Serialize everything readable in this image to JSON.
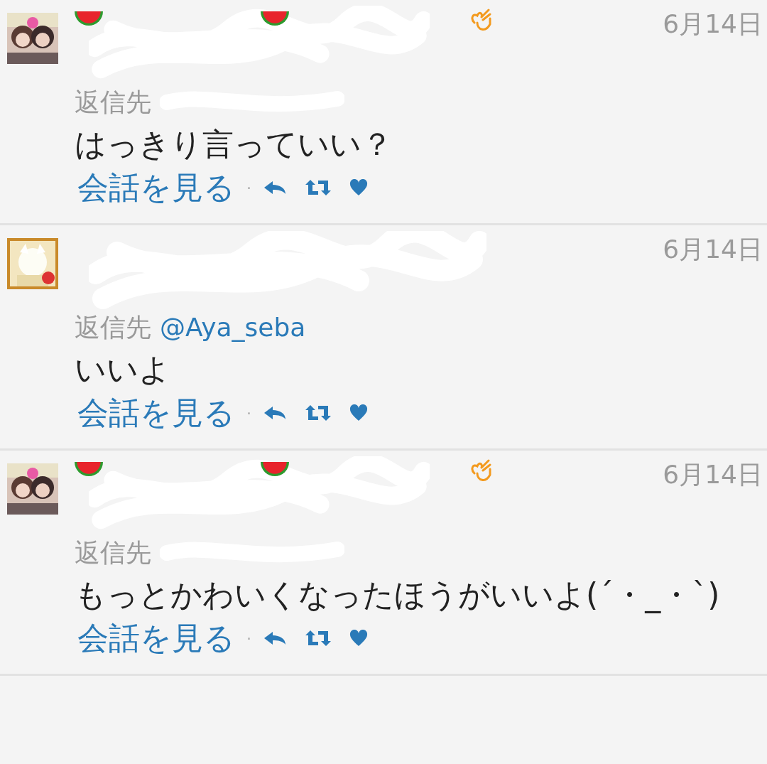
{
  "tweets": [
    {
      "kind": "decorated",
      "date": "6月14日",
      "reply_label": "返信先",
      "body": "はっきり言っていい？",
      "conversation_link": "会話を見る",
      "separator": "·"
    },
    {
      "kind": "plain",
      "date": "6月14日",
      "reply_label": "返信先",
      "reply_handle": "@Aya_seba",
      "body": "いいよ",
      "conversation_link": "会話を見る",
      "separator": "·"
    },
    {
      "kind": "decorated",
      "date": "6月14日",
      "reply_label": "返信先",
      "body": "もっとかわいくなったほうがいいよ(´・_・`)",
      "conversation_link": "会話を見る",
      "separator": "·"
    }
  ]
}
